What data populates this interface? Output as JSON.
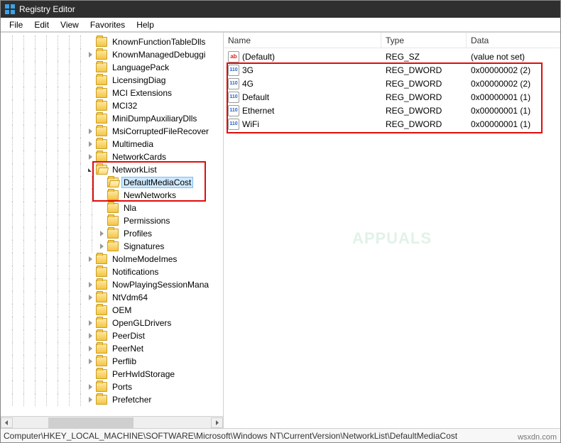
{
  "titlebar": {
    "title": "Registry Editor"
  },
  "menubar": {
    "file": "File",
    "edit": "Edit",
    "view": "View",
    "favorites": "Favorites",
    "help": "Help"
  },
  "tree": [
    {
      "depth": 7,
      "expander": "none",
      "open": false,
      "label": "KnownFunctionTableDlls"
    },
    {
      "depth": 7,
      "expander": "closed",
      "open": false,
      "label": "KnownManagedDebuggi"
    },
    {
      "depth": 7,
      "expander": "none",
      "open": false,
      "label": "LanguagePack"
    },
    {
      "depth": 7,
      "expander": "none",
      "open": false,
      "label": "LicensingDiag"
    },
    {
      "depth": 7,
      "expander": "none",
      "open": false,
      "label": "MCI Extensions"
    },
    {
      "depth": 7,
      "expander": "none",
      "open": false,
      "label": "MCI32"
    },
    {
      "depth": 7,
      "expander": "none",
      "open": false,
      "label": "MiniDumpAuxiliaryDlls"
    },
    {
      "depth": 7,
      "expander": "closed",
      "open": false,
      "label": "MsiCorruptedFileRecover"
    },
    {
      "depth": 7,
      "expander": "closed",
      "open": false,
      "label": "Multimedia"
    },
    {
      "depth": 7,
      "expander": "closed",
      "open": false,
      "label": "NetworkCards"
    },
    {
      "depth": 7,
      "expander": "open",
      "open": true,
      "label": "NetworkList"
    },
    {
      "depth": 8,
      "expander": "none",
      "open": true,
      "label": "DefaultMediaCost",
      "selected": true
    },
    {
      "depth": 8,
      "expander": "none",
      "open": false,
      "label": "NewNetworks"
    },
    {
      "depth": 8,
      "expander": "none",
      "open": false,
      "label": "Nla"
    },
    {
      "depth": 8,
      "expander": "none",
      "open": false,
      "label": "Permissions"
    },
    {
      "depth": 8,
      "expander": "closed",
      "open": false,
      "label": "Profiles"
    },
    {
      "depth": 8,
      "expander": "closed",
      "open": false,
      "label": "Signatures"
    },
    {
      "depth": 7,
      "expander": "closed",
      "open": false,
      "label": "NoImeModeImes"
    },
    {
      "depth": 7,
      "expander": "none",
      "open": false,
      "label": "Notifications"
    },
    {
      "depth": 7,
      "expander": "closed",
      "open": false,
      "label": "NowPlayingSessionMana"
    },
    {
      "depth": 7,
      "expander": "closed",
      "open": false,
      "label": "NtVdm64"
    },
    {
      "depth": 7,
      "expander": "none",
      "open": false,
      "label": "OEM"
    },
    {
      "depth": 7,
      "expander": "closed",
      "open": false,
      "label": "OpenGLDrivers"
    },
    {
      "depth": 7,
      "expander": "closed",
      "open": false,
      "label": "PeerDist"
    },
    {
      "depth": 7,
      "expander": "closed",
      "open": false,
      "label": "PeerNet"
    },
    {
      "depth": 7,
      "expander": "closed",
      "open": false,
      "label": "Perflib"
    },
    {
      "depth": 7,
      "expander": "none",
      "open": false,
      "label": "PerHwIdStorage"
    },
    {
      "depth": 7,
      "expander": "closed",
      "open": false,
      "label": "Ports"
    },
    {
      "depth": 7,
      "expander": "closed",
      "open": false,
      "label": "Prefetcher"
    }
  ],
  "columns": {
    "name": "Name",
    "type": "Type",
    "data": "Data"
  },
  "values": [
    {
      "icon": "sz",
      "name": "(Default)",
      "type": "REG_SZ",
      "data": "(value not set)"
    },
    {
      "icon": "dw",
      "name": "3G",
      "type": "REG_DWORD",
      "data": "0x00000002 (2)"
    },
    {
      "icon": "dw",
      "name": "4G",
      "type": "REG_DWORD",
      "data": "0x00000002 (2)"
    },
    {
      "icon": "dw",
      "name": "Default",
      "type": "REG_DWORD",
      "data": "0x00000001 (1)"
    },
    {
      "icon": "dw",
      "name": "Ethernet",
      "type": "REG_DWORD",
      "data": "0x00000001 (1)"
    },
    {
      "icon": "dw",
      "name": "WiFi",
      "type": "REG_DWORD",
      "data": "0x00000001 (1)"
    }
  ],
  "statusbar": {
    "path": "Computer\\HKEY_LOCAL_MACHINE\\SOFTWARE\\Microsoft\\Windows NT\\CurrentVersion\\NetworkList\\DefaultMediaCost"
  },
  "watermark": {
    "text": "APPUALS"
  },
  "sitemark": {
    "text": "wsxdn.com"
  },
  "iconglyph": {
    "sz": "ab",
    "dw": "011\n110"
  }
}
